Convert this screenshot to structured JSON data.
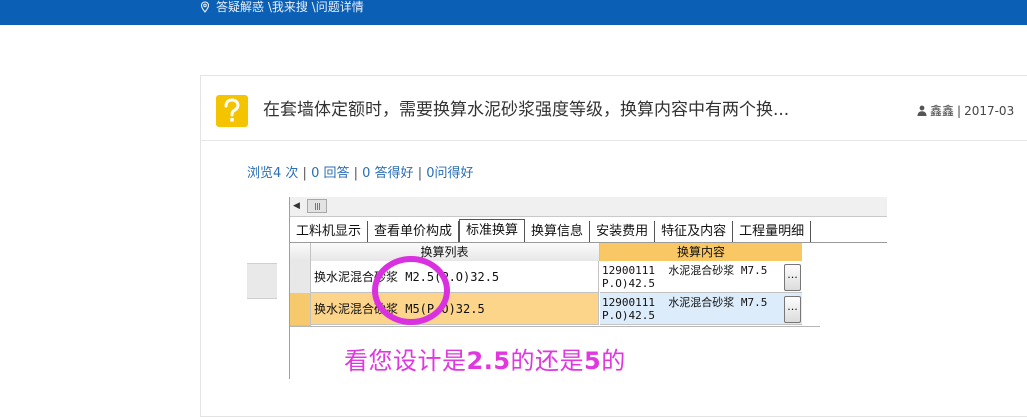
{
  "header": {
    "breadcrumb": "答疑解惑 \\我来搜 \\问题详情",
    "location_icon": "map-pin-icon",
    "accent_color": "#0b5fb5"
  },
  "question": {
    "icon": "question-mark-icon",
    "icon_color": "#f5c400",
    "title": "在套墙体定额时，需要换算水泥砂浆强度等级，换算内容中有两个换...",
    "user_icon": "user-icon",
    "author": "鑫鑫",
    "separator": "|",
    "date": "2017-03"
  },
  "stats": {
    "views": "浏览4 次",
    "answers": "0 回答",
    "good_answers": "0 答得好",
    "good_questions": "0问得好",
    "sep": "|"
  },
  "screenshot": {
    "tabs": [
      "工料机显示",
      "查看单价构成",
      "标准换算",
      "换算信息",
      "安装费用",
      "特征及内容",
      "工程量明细"
    ],
    "active_tab": "标准换算",
    "columns": [
      "换算列表",
      "换算内容"
    ],
    "rows": [
      {
        "list": "换水泥混合砂浆 M2.5(P.O)32.5",
        "content": "12900111  水泥混合砂浆 M7.5\nP.O)42.5",
        "button": "..."
      },
      {
        "list": "换水泥混合砂浆 M5(P.O)32.5",
        "content": "12900111  水泥混合砂浆 M7.5\nP.O)42.5",
        "button": "..."
      }
    ],
    "annotation_pre": "看您设计是",
    "annotation_num1": "2.5",
    "annotation_mid": "的还是",
    "annotation_num2": "5",
    "annotation_post": "的",
    "annotation_color": "#e037e0",
    "highlight_color": "#fcd48a"
  }
}
